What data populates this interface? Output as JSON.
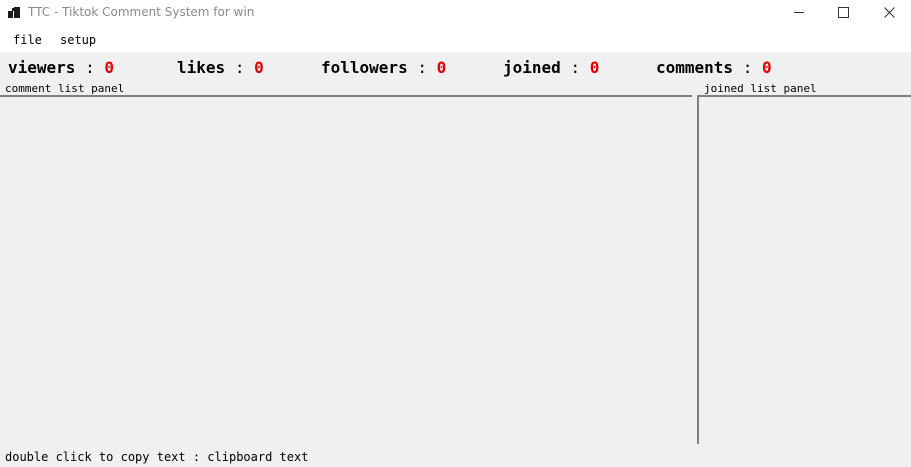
{
  "window": {
    "title": "TTC - Tiktok Comment System for win",
    "icon": "app-icon"
  },
  "menu": {
    "file": "file",
    "setup": "setup"
  },
  "stats": {
    "viewers_label": "viewers",
    "viewers_value": "0",
    "likes_label": "likes",
    "likes_value": "0",
    "followers_label": "followers",
    "followers_value": "0",
    "joined_label": "joined",
    "joined_value": "0",
    "comments_label": "comments",
    "comments_value": "0",
    "separator": ":",
    "value_color": "#e60000"
  },
  "panels": {
    "comment_label": "comment list panel",
    "joined_label": "joined list panel"
  },
  "status": {
    "text": "double click to copy text :  clipboard text"
  }
}
